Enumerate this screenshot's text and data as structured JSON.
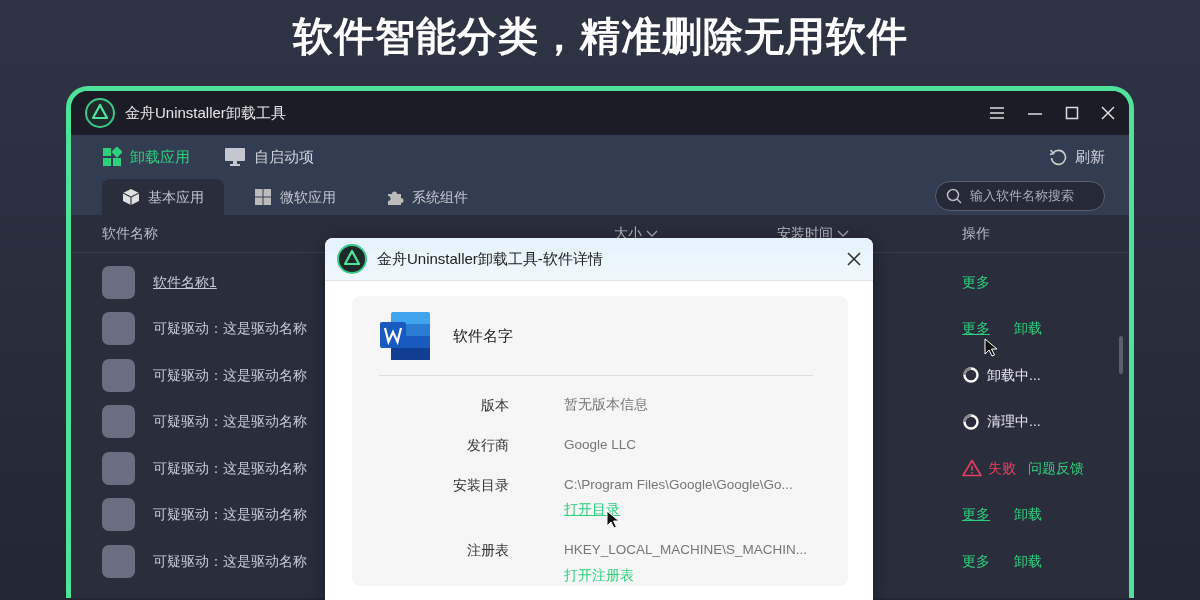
{
  "headline": "软件智能分类，精准删除无用软件",
  "window": {
    "title": "金舟Uninstaller卸载工具"
  },
  "nav": [
    {
      "label": "卸载应用",
      "selected": true
    },
    {
      "label": "自启动项",
      "selected": false
    }
  ],
  "refresh": "刷新",
  "tabs": [
    {
      "label": "基本应用",
      "selected": true
    },
    {
      "label": "微软应用",
      "selected": false
    },
    {
      "label": "系统组件",
      "selected": false
    }
  ],
  "search": {
    "placeholder": "输入软件名称搜索"
  },
  "columns": [
    "软件名称",
    "大小",
    "安装时间",
    "操作"
  ],
  "rows": [
    {
      "name": "软件名称1",
      "underlined": true,
      "actions": [
        {
          "kind": "link",
          "label": "更多",
          "underlined": false
        }
      ]
    },
    {
      "name": "可疑驱动：这是驱动名称",
      "underlined": false,
      "actions": [
        {
          "kind": "link",
          "label": "更多",
          "underlined": true
        },
        {
          "kind": "link",
          "label": "卸载",
          "underlined": false
        }
      ]
    },
    {
      "name": "可疑驱动：这是驱动名称",
      "underlined": false,
      "actions": [
        {
          "kind": "progress",
          "label": "卸载中..."
        }
      ]
    },
    {
      "name": "可疑驱动：这是驱动名称",
      "underlined": false,
      "actions": [
        {
          "kind": "progress",
          "label": "清理中..."
        }
      ]
    },
    {
      "name": "可疑驱动：这是驱动名称",
      "underlined": false,
      "actions": [
        {
          "kind": "error",
          "label": "失败"
        },
        {
          "kind": "link",
          "label": "问题反馈",
          "underlined": false
        }
      ]
    },
    {
      "name": "可疑驱动：这是驱动名称",
      "underlined": false,
      "actions": [
        {
          "kind": "link",
          "label": "更多",
          "underlined": true
        },
        {
          "kind": "link",
          "label": "卸载",
          "underlined": false
        }
      ]
    },
    {
      "name": "可疑驱动：这是驱动名称",
      "underlined": false,
      "actions": [
        {
          "kind": "link",
          "label": "更多",
          "underlined": false
        },
        {
          "kind": "link",
          "label": "卸载",
          "underlined": false
        }
      ]
    }
  ],
  "dialog": {
    "title": "金舟Uninstaller卸载工具-软件详情",
    "app_name": "软件名字",
    "fields": [
      {
        "label": "版本",
        "value": "暂无版本信息"
      },
      {
        "label": "发行商",
        "value": "Google LLC"
      },
      {
        "label": "安装目录",
        "value": "C:\\Program Files\\Google\\Google\\Go...",
        "link": {
          "label": "打开目录",
          "underlined": true
        }
      },
      {
        "label": "注册表",
        "value": "HKEY_LOCAL_MACHINE\\S_MACHIN...",
        "link": {
          "label": "打开注册表",
          "underlined": false
        }
      }
    ]
  }
}
